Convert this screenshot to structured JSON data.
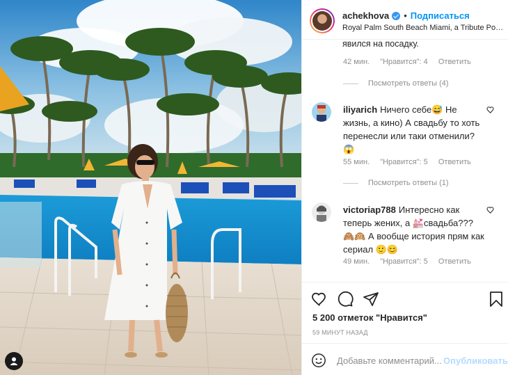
{
  "header": {
    "username": "achekhova",
    "follow_label": "Подписаться",
    "separator": "•",
    "location": "Royal Palm South Beach Miami, a Tribute Portfolio Resort"
  },
  "comments": {
    "partial_text": "явился на посадку.",
    "first_meta": {
      "time": "42 мин.",
      "likes": "\"Нравится\": 4",
      "reply": "Ответить"
    },
    "first_view_replies": "Посмотреть ответы (4)",
    "items": [
      {
        "username": "iliyarich",
        "text": "Ничего себе😅 Не жизнь, а кино) А свадьбу то хоть перенесли или таки отменили? 😱",
        "time": "55 мин.",
        "likes": "\"Нравится\": 5",
        "reply": "Ответить",
        "view_replies": "Посмотреть ответы (1)"
      },
      {
        "username": "victoriap788",
        "text": "Интересно как теперь жених, а 💒свадьба??? 🙈🙉 А вообще история прям как сериал 🙂😊",
        "time": "49 мин.",
        "likes": "\"Нравится\": 5",
        "reply": "Ответить"
      }
    ]
  },
  "actions": {
    "likes_count": "5 200 отметок \"Нравится\"",
    "posted_time": "59 МИНУТ НАЗАД"
  },
  "add_comment": {
    "placeholder": "Добавьте комментарий...",
    "publish_label": "Опубликовать"
  },
  "colors": {
    "accent": "#0095f6",
    "muted": "#8e8e8e",
    "publish_disabled": "#b3dbff"
  },
  "icons": [
    "heart-icon",
    "comment-icon",
    "share-icon",
    "bookmark-icon",
    "emoji-icon",
    "user-tag-icon",
    "verified-icon"
  ]
}
